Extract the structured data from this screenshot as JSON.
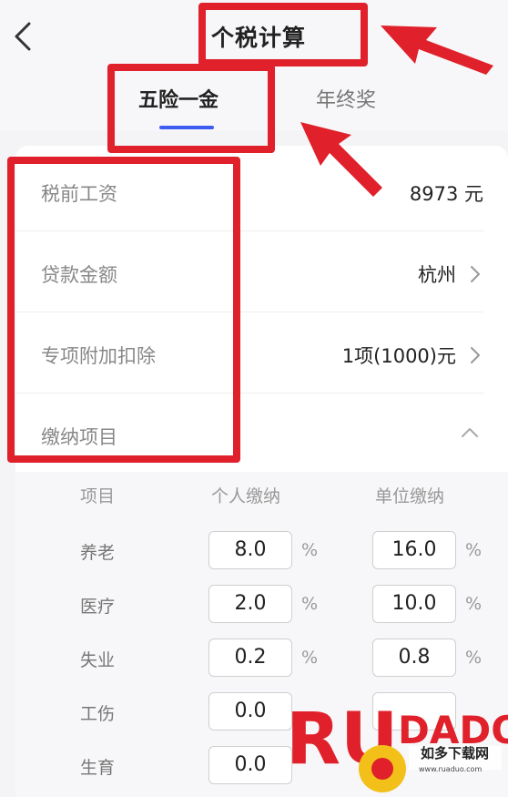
{
  "header": {
    "title": "个税计算"
  },
  "tabs": [
    {
      "label": "五险一金"
    },
    {
      "label": "年终奖"
    }
  ],
  "form": {
    "rows": [
      {
        "label": "税前工资",
        "value": "8973 元"
      },
      {
        "label": "贷款金额",
        "value": "杭州"
      },
      {
        "label": "专项附加扣除",
        "value": "1项(1000)元"
      },
      {
        "label": "缴纳项目",
        "value": ""
      }
    ]
  },
  "contributions": {
    "headers": [
      "项目",
      "个人缴纳",
      "单位缴纳"
    ],
    "items": [
      {
        "name": "养老",
        "personal": "8.0",
        "company": "16.0"
      },
      {
        "name": "医疗",
        "personal": "2.0",
        "company": "10.0"
      },
      {
        "name": "失业",
        "personal": "0.2",
        "company": "0.8"
      },
      {
        "name": "工伤",
        "personal": "0.0",
        "company": ""
      },
      {
        "name": "生育",
        "personal": "0.0",
        "company": ""
      }
    ],
    "unit": "%"
  },
  "watermark": {
    "brand": "RUADADO",
    "name": "如多下载网",
    "url": "www.ruaduo.com"
  },
  "colors": {
    "accent": "#3e5cf2",
    "annotation": "#e0202a"
  }
}
